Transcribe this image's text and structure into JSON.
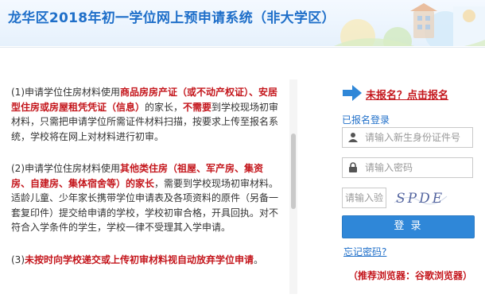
{
  "header": {
    "title": "龙华区2018年初一学位网上预申请系统（非大学区）"
  },
  "notice": {
    "p1": {
      "prefix": "(1)申请学位住房材料使用",
      "red1": "商品房房产证（或不动产权证）、安居型住房或房屋租凭凭证（信息）",
      "mid": "的家长，",
      "red2": "不需要",
      "suffix": "到学校现场初审材料，只需把申请学位所需证件材料扫描，按要求上传至报名系统，学校将在网上对材料进行初审。"
    },
    "p2": {
      "prefix": "(2)申请学位住房材料使用",
      "red1": "其他类住房（祖屋、军产房、集资房、自建房、集体宿舍等）的家长",
      "suffix": "，需要到学校现场初审材料。适龄儿童、少年家长携带学位申请表及各项资料的原件（另备一套复印件）提交给申请的学校，学校初审合格，开具回执。对不符合入学条件的学生，学校一律不受理其入学申请。"
    },
    "p3": {
      "prefix": "(3)",
      "red1": "未按时向学校递交或上传初审材料视自动放弃学位申请",
      "suffix": "。"
    }
  },
  "login": {
    "register_link": "未报名？点击报名",
    "registered_label": "已报名登录",
    "id_placeholder": "请输入新生身份证件号",
    "password_placeholder": "请输入密码",
    "captcha_placeholder": "请输入验证码",
    "captcha_text": "SPDE",
    "login_button": "登 录",
    "forgot_password": "忘记密码?",
    "browser_hint": "（推荐浏览器：谷歌浏览器）"
  },
  "colors": {
    "brand": "#1f6fc9",
    "alert": "#c4161c",
    "button": "#2f87d8"
  }
}
